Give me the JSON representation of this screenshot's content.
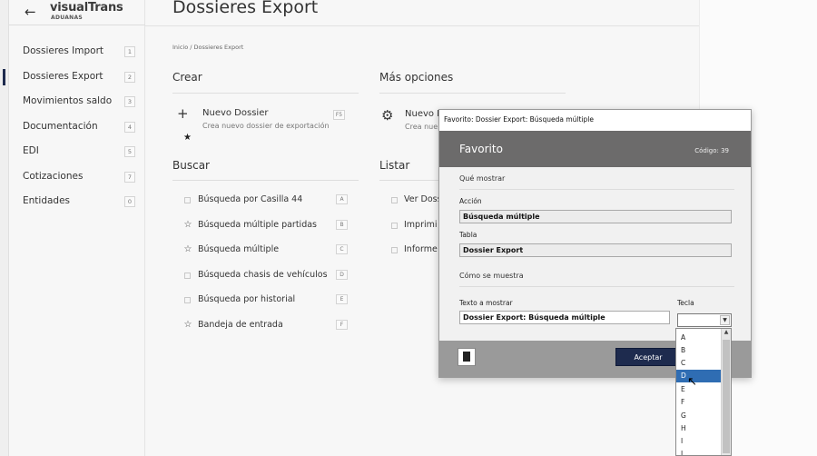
{
  "app": {
    "logo_name": "visualTrans",
    "logo_sub": "ADUANAS"
  },
  "sidebar": {
    "items": [
      {
        "label": "Dossieres Import",
        "key": "1"
      },
      {
        "label": "Dossieres Export",
        "key": "2",
        "active": true
      },
      {
        "label": "Movimientos saldo",
        "key": "3"
      },
      {
        "label": "Documentación",
        "key": "4"
      },
      {
        "label": "EDI",
        "key": "5"
      },
      {
        "label": "Cotizaciones",
        "key": "7"
      },
      {
        "label": "Entidades",
        "key": "0"
      }
    ]
  },
  "main": {
    "title": "Dossieres Export",
    "breadcrumb": "Inicio / Dossieres Export",
    "crear": {
      "heading": "Crear",
      "items": [
        {
          "name": "Nuevo Dossier",
          "desc": "Crea nuevo dossier de exportación",
          "key": "F5"
        }
      ]
    },
    "mas_opciones": {
      "heading": "Más opciones",
      "items": [
        {
          "name": "Nuevo D",
          "desc": "Crea nue"
        }
      ]
    },
    "buscar": {
      "heading": "Buscar",
      "items": [
        {
          "name": "Búsqueda por Casilla 44",
          "key": "A",
          "fav": false
        },
        {
          "name": "Búsqueda múltiple partidas",
          "key": "B",
          "fav": true
        },
        {
          "name": "Búsqueda múltiple",
          "key": "C",
          "fav": true
        },
        {
          "name": "Búsqueda chasis de vehículos",
          "key": "D",
          "fav": false
        },
        {
          "name": "Búsqueda por historial",
          "key": "E",
          "fav": false
        },
        {
          "name": "Bandeja de entrada",
          "key": "F",
          "fav": true
        }
      ]
    },
    "listar": {
      "heading": "Listar",
      "items": [
        {
          "name": "Ver Doss"
        },
        {
          "name": "Imprimi"
        },
        {
          "name": "Informe"
        }
      ]
    }
  },
  "dialog": {
    "window_title": "Favorito: Dossier Export: Búsqueda múltiple",
    "header": "Favorito",
    "code": "Código: 39",
    "section_what": "Qué mostrar",
    "accion_label": "Acción",
    "accion_value": "Búsqueda múltiple",
    "tabla_label": "Tabla",
    "tabla_value": "Dossier Export",
    "section_how": "Cómo se muestra",
    "texto_label": "Texto a mostrar",
    "texto_value": "Dossier Export: Búsqueda múltiple",
    "tecla_label": "Tecla",
    "tecla_value": "",
    "accept_label": "Aceptar",
    "dropdown_options": [
      "A",
      "B",
      "C",
      "D",
      "E",
      "F",
      "G",
      "H",
      "I",
      "J"
    ],
    "dropdown_selected": "D"
  },
  "colors": {
    "accent": "#1e2b4e",
    "dialog_header": "#6c6b6b",
    "selection": "#2f6db3"
  }
}
